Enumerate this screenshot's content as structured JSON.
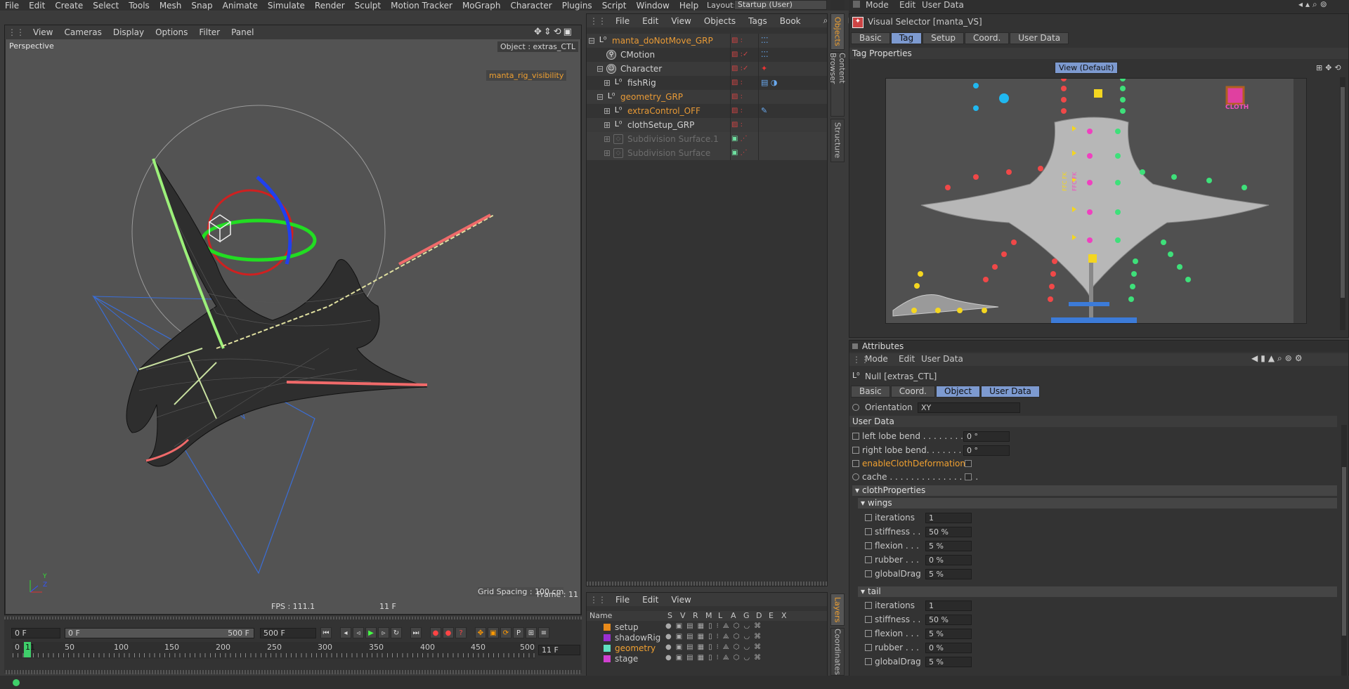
{
  "menubar": {
    "items": [
      "File",
      "Edit",
      "Create",
      "Select",
      "Tools",
      "Mesh",
      "Snap",
      "Animate",
      "Simulate",
      "Render",
      "Sculpt",
      "Motion Tracker",
      "MoGraph",
      "Character",
      "Plugins",
      "Script",
      "Window",
      "Help"
    ],
    "layout_label": "Layout:",
    "layout_value": "Startup (User)"
  },
  "viewport": {
    "menu": [
      "View",
      "Cameras",
      "Display",
      "Options",
      "Filter",
      "Panel"
    ],
    "label": "Perspective",
    "object_label": "Object : extras_CTL",
    "rig_visibility": "manta_rig_visibility",
    "grid_spacing": "Grid Spacing : 100 cm",
    "frame": "Frame : 11",
    "fps": "FPS : 111.1",
    "frame_readout": "11 F",
    "axis_y": "Y",
    "axis_z": "Z"
  },
  "timeline": {
    "start_field": "0 F",
    "slider_left": "0 F",
    "slider_right": "500 F",
    "end_field": "500 F",
    "current_field": "11 F",
    "ticks": [
      "0",
      "50",
      "100",
      "150",
      "200",
      "250",
      "300",
      "350",
      "400",
      "450",
      "500"
    ],
    "current_tick": "11"
  },
  "object_manager": {
    "menu": [
      "File",
      "Edit",
      "View",
      "Objects",
      "Tags",
      "Book"
    ],
    "objects": [
      {
        "name": "manta_doNotMove_GRP",
        "color": "#e89a36"
      },
      {
        "name": "CMotion",
        "color": "#d0d0d0"
      },
      {
        "name": "Character",
        "color": "#d0d0d0"
      },
      {
        "name": "fishRig",
        "color": "#d0d0d0"
      },
      {
        "name": "geometry_GRP",
        "color": "#e89a36"
      },
      {
        "name": "extraControl_OFF",
        "color": "#e89a36"
      },
      {
        "name": "clothSetup_GRP",
        "color": "#d0d0d0"
      },
      {
        "name": "Subdivision Surface.1",
        "color": "#6d6d6d"
      },
      {
        "name": "Subdivision Surface",
        "color": "#6d6d6d"
      }
    ],
    "side_tabs": [
      "Objects",
      "Content Browser",
      "Structure"
    ]
  },
  "layer_manager": {
    "menu": [
      "File",
      "Edit",
      "View"
    ],
    "headers": [
      "Name",
      "S",
      "V",
      "R",
      "M",
      "L",
      "A",
      "G",
      "D",
      "E",
      "X"
    ],
    "layers": [
      {
        "name": "setup",
        "color": "#e88a1a"
      },
      {
        "name": "shadowRig",
        "color": "#9a2fd0"
      },
      {
        "name": "geometry",
        "color": "#5fe0c0"
      },
      {
        "name": "stage",
        "color": "#d040d0"
      }
    ],
    "side_tabs": [
      "Layers",
      "Coordinates"
    ]
  },
  "tag_panel": {
    "menu": [
      "Mode",
      "Edit",
      "User Data"
    ],
    "title": "Visual Selector [manta_VS]",
    "tabs": [
      "Basic",
      "Tag",
      "Setup",
      "Coord.",
      "User Data"
    ],
    "active_tab": "Tag",
    "section": "Tag Properties",
    "view_button": "View (Default)",
    "cloth_label": "CLOTH",
    "fk_labels": [
      "FFC FK",
      "FFC FK"
    ]
  },
  "attributes": {
    "title_bar": "Attributes",
    "menu": [
      "Mode",
      "Edit",
      "User Data"
    ],
    "object_title": "Null [extras_CTL]",
    "tabs": [
      "Basic",
      "Coord.",
      "Object",
      "User Data"
    ],
    "orientation_label": "Orientation",
    "orientation_value": "XY",
    "user_data_section": "User Data",
    "rows": [
      {
        "label": "left lobe bend . . . . . . . . .",
        "value": "0 °"
      },
      {
        "label": "right lobe bend. . . . . . . .",
        "value": "0 °"
      }
    ],
    "enable_cloth_label": "enableClothDeformation",
    "cache_label": "cache . . . . . . . . . . . . . . . . .",
    "cloth_group": "clothProperties",
    "wings_group": "wings",
    "tail_group": "tail",
    "wings": [
      {
        "label": "iterations",
        "value": "1"
      },
      {
        "label": "stiffness . .",
        "value": "50 %"
      },
      {
        "label": "flexion . . .",
        "value": "5 %"
      },
      {
        "label": "rubber . . .",
        "value": "0 %"
      },
      {
        "label": "globalDrag",
        "value": "5 %"
      }
    ],
    "tail": [
      {
        "label": "iterations",
        "value": "1"
      },
      {
        "label": "stiffness . .",
        "value": "50 %"
      },
      {
        "label": "flexion . . .",
        "value": "5 %"
      },
      {
        "label": "rubber . . .",
        "value": "0 %"
      },
      {
        "label": "globalDrag",
        "value": "5 %"
      }
    ]
  }
}
